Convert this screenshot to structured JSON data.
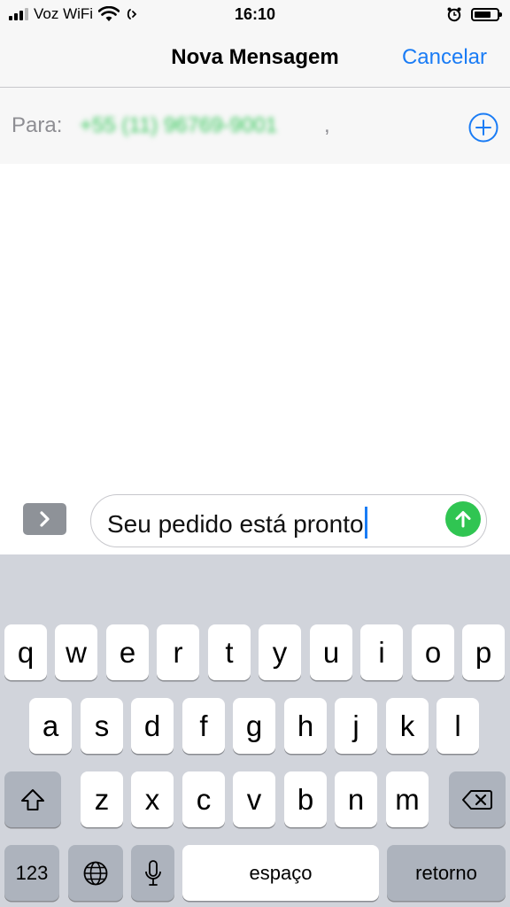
{
  "status_bar": {
    "carrier": "Voz WiFi",
    "time": "16:10",
    "icons": [
      "signal-icon",
      "wifi-icon",
      "wifi-calling-icon",
      "alarm-icon",
      "battery-icon"
    ]
  },
  "nav": {
    "title": "Nova Mensagem",
    "cancel_label": "Cancelar"
  },
  "recipient": {
    "label": "Para:",
    "value": "+55 (11) 96769-9001",
    "separator": ","
  },
  "composer": {
    "text": "Seu pedido está pronto"
  },
  "keyboard": {
    "row1": [
      "q",
      "w",
      "e",
      "r",
      "t",
      "y",
      "u",
      "i",
      "o",
      "p"
    ],
    "row2": [
      "a",
      "s",
      "d",
      "f",
      "g",
      "h",
      "j",
      "k",
      "l"
    ],
    "row3": [
      "z",
      "x",
      "c",
      "v",
      "b",
      "n",
      "m"
    ],
    "numbers_label": "123",
    "space_label": "espaço",
    "return_label": "retorno"
  },
  "colors": {
    "accent": "#1a7cf5",
    "send": "#30c552",
    "recipient": "#34c759",
    "keyboard_bg": "#d1d4db"
  }
}
